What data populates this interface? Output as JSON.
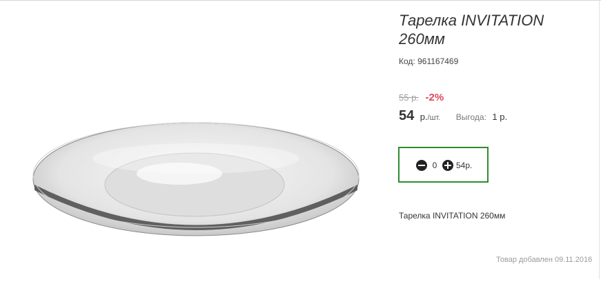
{
  "product": {
    "title": "Тарелка INVITATION 260мм",
    "code_label": "Код:",
    "code_value": "961167469",
    "description": "Тарелка INVITATION 260мм",
    "added_text": "Товар добавлен 09.11.2016"
  },
  "pricing": {
    "old_price": "55 р.",
    "discount": "-2%",
    "price": "54",
    "unit": "р.",
    "unit_suffix": "/шт.",
    "benefit_label": "Выгода:",
    "benefit_value": "1 р."
  },
  "cart": {
    "quantity": "0",
    "total": "54р."
  },
  "icons": {
    "decrease": "minus-circle-icon",
    "increase": "plus-circle-icon"
  },
  "colors": {
    "discount": "#e0455c",
    "cart_border": "#2e8b2e"
  }
}
